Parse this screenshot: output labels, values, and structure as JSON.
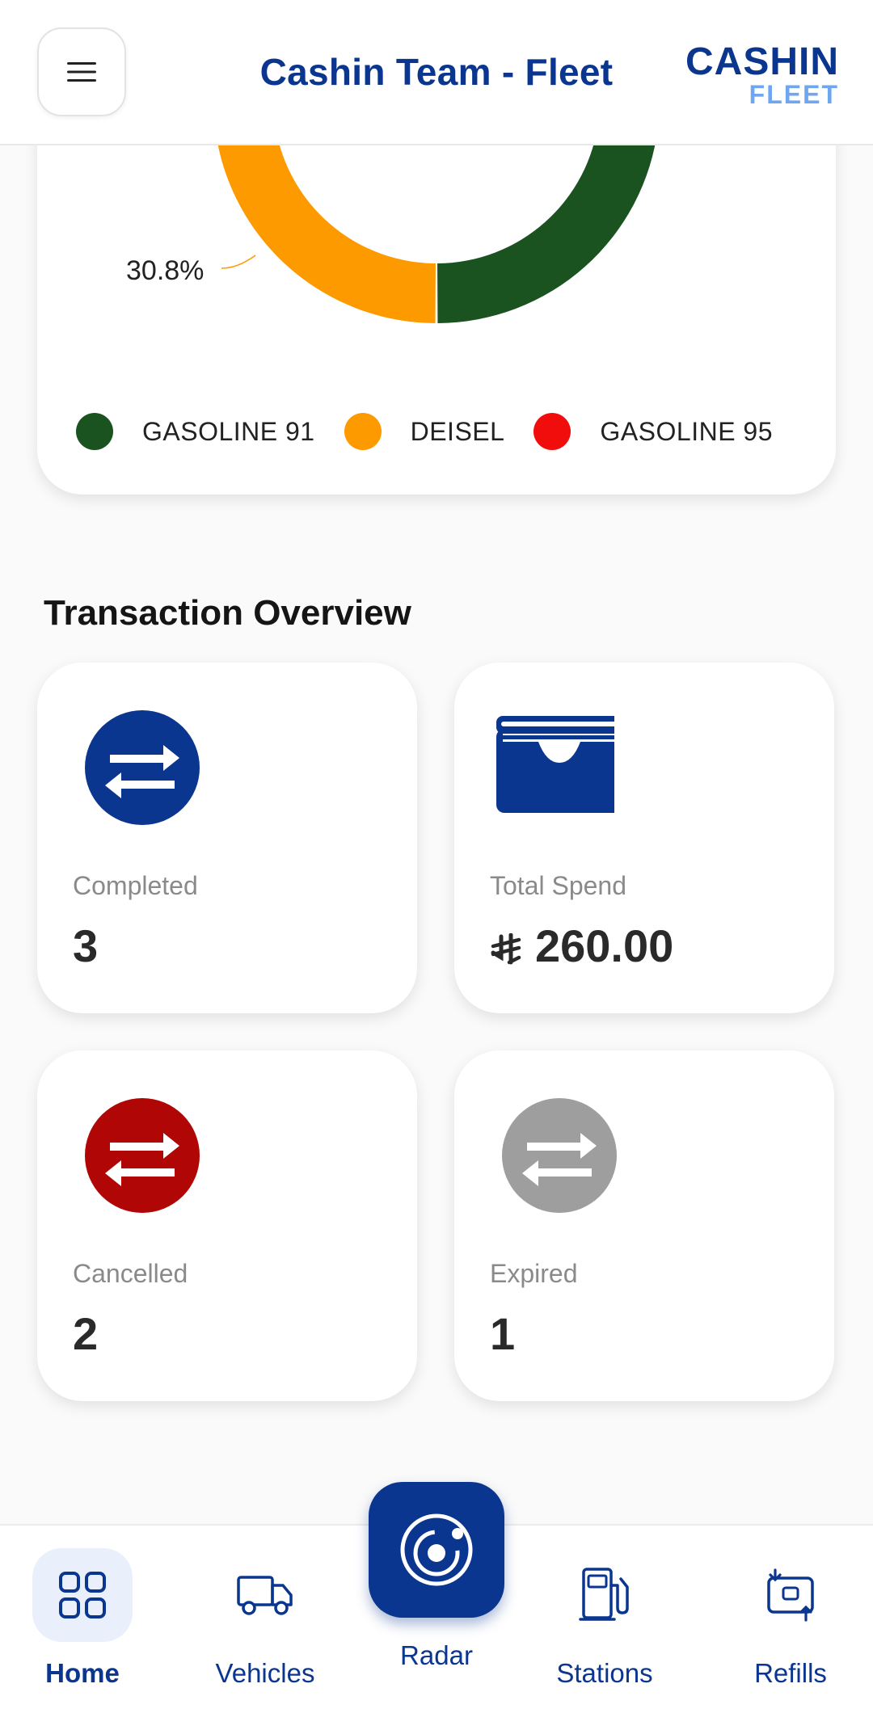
{
  "header": {
    "title": "Cashin Team - Fleet",
    "logo_top": "CASHIN",
    "logo_bottom": "FLEET",
    "menu_icon": "hamburger-menu-icon"
  },
  "fuel_chart": {
    "visible_slice_label": "30.8%",
    "center_value_partial": "...",
    "colors": {
      "gasoline_91": "#1a5220",
      "deisel": "#fd9a00",
      "gasoline_95": "#f20d0d"
    }
  },
  "chart_data": {
    "type": "pie",
    "categories": [
      "GASOLINE 91",
      "DEISEL",
      "GASOLINE 95"
    ],
    "values": [
      69.2,
      30.8,
      0
    ],
    "legend_position": "bottom"
  },
  "legend": [
    {
      "label": "GASOLINE 91",
      "color": "#1a5220"
    },
    {
      "label": "DEISEL",
      "color": "#fd9a00"
    },
    {
      "label": "GASOLINE 95",
      "color": "#f20d0d"
    }
  ],
  "transaction_overview": {
    "title": "Transaction Overview",
    "cards": [
      {
        "label": "Completed",
        "value": "3",
        "icon": "transfer-arrows-icon",
        "color": "#0b3690"
      },
      {
        "label": "Total Spend",
        "value": "260.00",
        "icon": "wallet-cards-icon",
        "currency_icon": "saudi-riyal-icon",
        "color": "#0b3690"
      },
      {
        "label": "Cancelled",
        "value": "2",
        "icon": "transfer-arrows-icon",
        "color": "#b00606"
      },
      {
        "label": "Expired",
        "value": "1",
        "icon": "transfer-arrows-icon",
        "color": "#9e9e9e"
      }
    ]
  },
  "bottom_nav": {
    "items": [
      {
        "label": "Home",
        "icon": "grid-icon",
        "active": true
      },
      {
        "label": "Vehicles",
        "icon": "truck-icon",
        "active": false
      },
      {
        "label": "Radar",
        "icon": "radar-orbit-icon",
        "active": false
      },
      {
        "label": "Stations",
        "icon": "fuel-pump-icon",
        "active": false
      },
      {
        "label": "Refills",
        "icon": "refill-card-icon",
        "active": false
      }
    ]
  }
}
